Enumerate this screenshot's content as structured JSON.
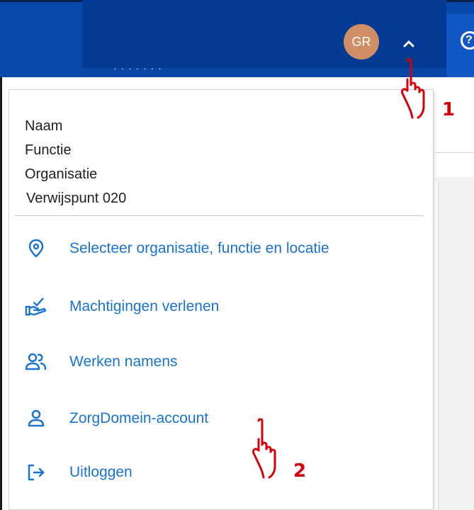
{
  "header": {
    "avatar_initials": "GR",
    "chevron_icon": "chevron-up-icon",
    "help_icon": "help-icon",
    "colors": {
      "bar": "#0748a8",
      "bar_dark": "#033a93",
      "avatar": "#cf8e66"
    }
  },
  "user": {
    "name": "Naam",
    "function": "Functie",
    "organisation": "Organisatie",
    "location": "Verwijspunt 020"
  },
  "menu": {
    "items": [
      {
        "label": "Selecteer organisatie, functie en locatie",
        "icon": "location-pin-icon"
      },
      {
        "label": "Machtigingen verlenen",
        "icon": "hand-checkmark-icon"
      },
      {
        "label": "Werken namens",
        "icon": "users-icon"
      },
      {
        "label": "ZorgDomein-account",
        "icon": "user-icon"
      },
      {
        "label": "Uitloggen",
        "icon": "logout-icon"
      }
    ],
    "link_color": "#1a73d1"
  },
  "annotations": {
    "step1": "1",
    "step2": "2",
    "color": "#d4000a"
  }
}
